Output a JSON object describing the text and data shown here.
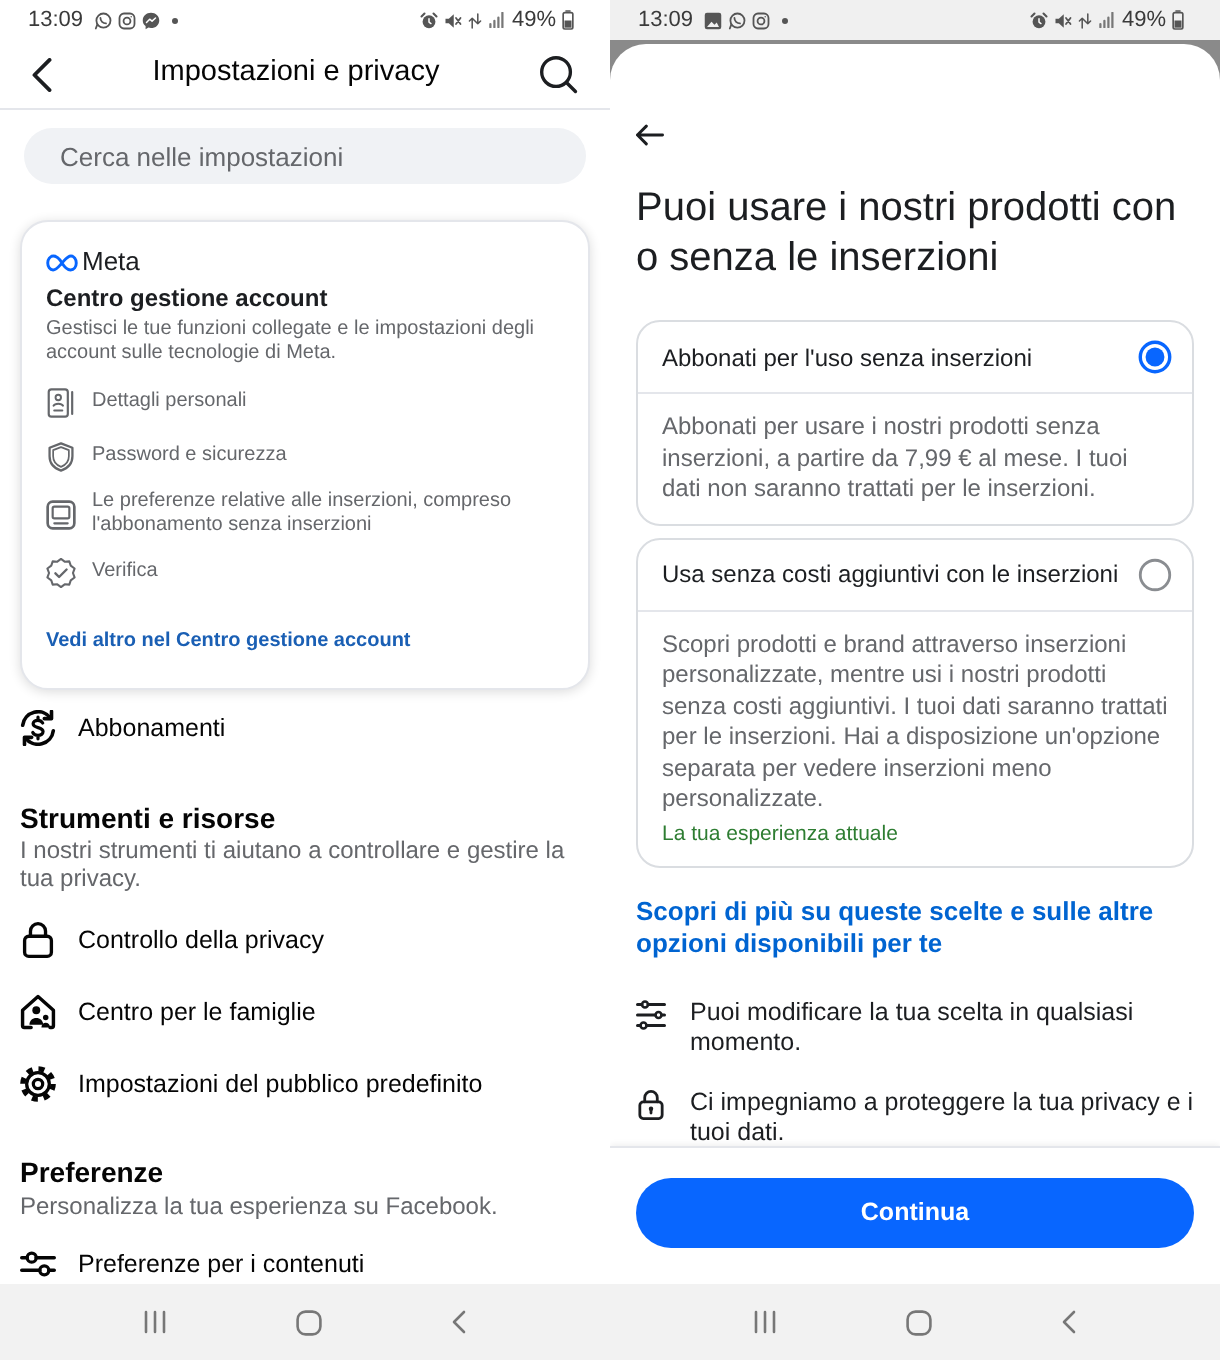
{
  "left_screen": {
    "status_bar": {
      "time": "13:09",
      "battery": "49%"
    },
    "header": {
      "title": "Impostazioni e privacy"
    },
    "search": {
      "placeholder": "Cerca nelle impostazioni"
    },
    "accounts_center": {
      "logo": "Meta",
      "title": "Centro gestione account",
      "description": "Gestisci le tue funzioni collegate e le impostazioni degli account sulle tecnologie di Meta.",
      "items": [
        {
          "label": "Dettagli personali"
        },
        {
          "label": "Password e sicurezza"
        },
        {
          "label": "Le preferenze relative alle inserzioni, compreso l'abbonamento senza inserzioni"
        },
        {
          "label": "Verifica"
        }
      ],
      "link": "Vedi altro nel Centro gestione account"
    },
    "menu_items": [
      {
        "label": "Abbonamenti"
      }
    ],
    "sections": [
      {
        "title": "Strumenti e risorse",
        "description": "I nostri strumenti ti aiutano a controllare e gestire la tua privacy.",
        "items": [
          {
            "label": "Controllo della privacy"
          },
          {
            "label": "Centro per le famiglie"
          },
          {
            "label": "Impostazioni del pubblico predefinito"
          }
        ]
      },
      {
        "title": "Preferenze",
        "description": "Personalizza la tua esperienza su Facebook.",
        "items": [
          {
            "label": "Preferenze per i contenuti"
          }
        ]
      }
    ]
  },
  "right_screen": {
    "status_bar": {
      "time": "13:09",
      "battery": "49%"
    },
    "heading": "Puoi usare i nostri prodotti con o senza le inserzioni",
    "options": [
      {
        "title": "Abbonati per l'uso senza inserzioni",
        "description": "Abbonati per usare i nostri prodotti senza inserzioni, a partire da 7,99 € al mese. I tuoi dati non saranno trattati per le inserzioni.",
        "selected": true
      },
      {
        "title": "Usa senza costi aggiuntivi con le inserzioni",
        "description": "Scopri prodotti e brand attraverso inserzioni personalizzate, mentre usi i nostri prodotti senza costi aggiuntivi. I tuoi dati saranno trattati per le inserzioni. Hai a disposizione un'opzione separata per vedere inserzioni meno personalizzate.",
        "note": "La tua esperienza attuale",
        "selected": false
      }
    ],
    "link": "Scopri di più su queste scelte e sulle altre opzioni disponibili per te",
    "info": [
      {
        "text": "Puoi modificare la tua scelta in qualsiasi momento."
      },
      {
        "text": "Ci impegniamo a proteggere la tua privacy e i tuoi dati."
      }
    ],
    "button": "Continua"
  }
}
